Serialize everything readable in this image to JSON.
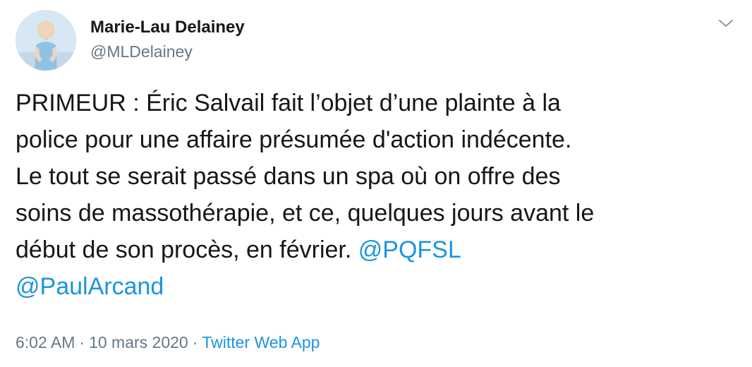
{
  "author": {
    "display_name": "Marie-Lau Delainey",
    "handle": "@MLDelainey"
  },
  "tweet": {
    "lines": [
      "PRIMEUR : Éric Salvail fait l’objet d’une plainte à la",
      "police pour une affaire présumée  d'action indécente.",
      "Le tout se serait passé dans un spa où on offre des",
      "soins de massothérapie, et ce, quelques jours avant le",
      "début de son procès, en février. "
    ],
    "mentions": [
      "@PQFSL",
      "@PaulArcand"
    ]
  },
  "meta": {
    "time": "6:02 AM",
    "separator": "·",
    "date": "10 mars 2020",
    "source": "Twitter Web App"
  },
  "colors": {
    "link": "#1b95e0",
    "secondary_text": "#657786",
    "primary_text": "#14171a"
  },
  "icons": {
    "menu": "chevron-down-icon"
  }
}
